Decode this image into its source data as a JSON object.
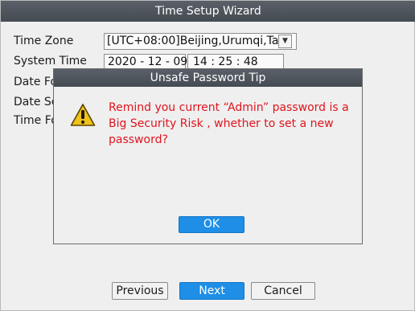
{
  "wizard": {
    "title": "Time Setup Wizard",
    "fields": {
      "time_zone_label": "Time Zone",
      "time_zone_value": "[UTC+08:00]Beijing,Urumqi,Ta",
      "system_time_label": "System Time",
      "date_value": "2020 - 12 - 09",
      "time_value": "14 : 25 : 48",
      "date_format_label": "Date Fo",
      "date_separator_label": "Date Se",
      "time_format_label": "Time Fo"
    },
    "buttons": {
      "previous": "Previous",
      "next": "Next",
      "cancel": "Cancel"
    }
  },
  "dialog": {
    "title": "Unsafe Password Tip",
    "message": "Remind you current “Admin” password is a Big Security Risk , whether to set a new password?",
    "ok_label": "OK"
  },
  "colors": {
    "titlebar": "#4c525a",
    "accent_button": "#1e8ee6",
    "warning_text": "#e0141e",
    "warning_icon": "#f2c21a"
  },
  "icons": {
    "warning": "warning-triangle-icon",
    "dropdown": "chevron-down-icon"
  }
}
